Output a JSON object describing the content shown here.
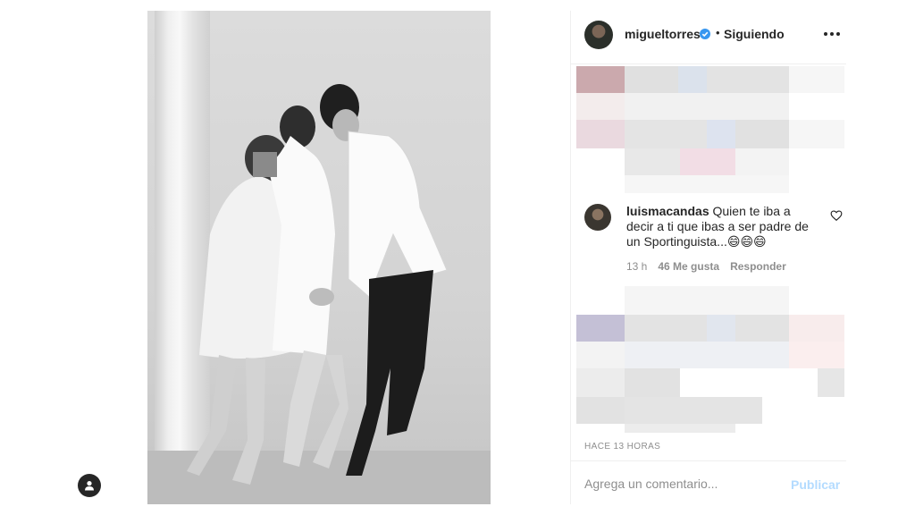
{
  "post": {
    "username": "migueltorres",
    "verified": true,
    "separator": "•",
    "follow_status": "Siguiendo"
  },
  "comment": {
    "username": "luismacandas",
    "text": "Quien te iba a decir a ti que ibas a ser padre de un Sportinguista...😄😄😄",
    "time": "13 h",
    "likes": "46 Me gusta",
    "reply": "Responder"
  },
  "timestamp": "HACE 13 HORAS",
  "comment_box": {
    "placeholder": "Agrega un comentario...",
    "publish_label": "Publicar"
  },
  "colors": {
    "accent": "#3897f0",
    "publish_disabled": "#b3dbff",
    "muted_text": "#8e8e8e"
  }
}
